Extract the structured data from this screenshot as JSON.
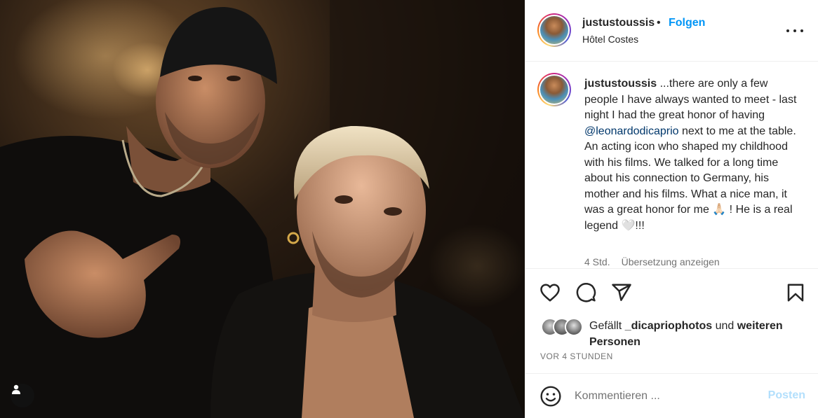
{
  "post": {
    "username": "justustoussis",
    "separator": "•",
    "follow_label": "Folgen",
    "location": "Hôtel Costes",
    "more_icon": "more-horizontal-icon"
  },
  "caption": {
    "username": "justustoussis",
    "text_before": " ...there are only a few people I have always wanted to meet - last night I had the great honor of having ",
    "mention": "@leonardodicaprio",
    "text_middle": " next to me at the table. An acting icon who shaped my childhood with his films. We talked for a long time about his connection to Germany, his mother and his films. What a nice man, it was a great honor for me ",
    "emoji_1": "🙏🏻",
    "text_after": " ! He is a real legend ",
    "emoji_2": "🤍",
    "text_end": "!!!",
    "time": "4 Std.",
    "translate_label": "Übersetzung anzeigen"
  },
  "actions": {
    "like_icon": "heart-icon",
    "comment_icon": "comment-icon",
    "share_icon": "share-icon",
    "save_icon": "bookmark-icon"
  },
  "likes": {
    "prefix": "Gefällt ",
    "user": "_dicapriophotos",
    "connector": " und ",
    "others": "weiteren Personen"
  },
  "timestamp": "VOR 4 STUNDEN",
  "comment": {
    "placeholder": "Kommentieren ...",
    "post_label": "Posten",
    "emoji_icon": "smiley-icon"
  },
  "photo": {
    "user_tag_icon": "user-tag-icon"
  },
  "colors": {
    "accent": "#0095f6",
    "mention": "#00376b",
    "muted": "#737373",
    "post_disabled": "#b2dffc"
  }
}
